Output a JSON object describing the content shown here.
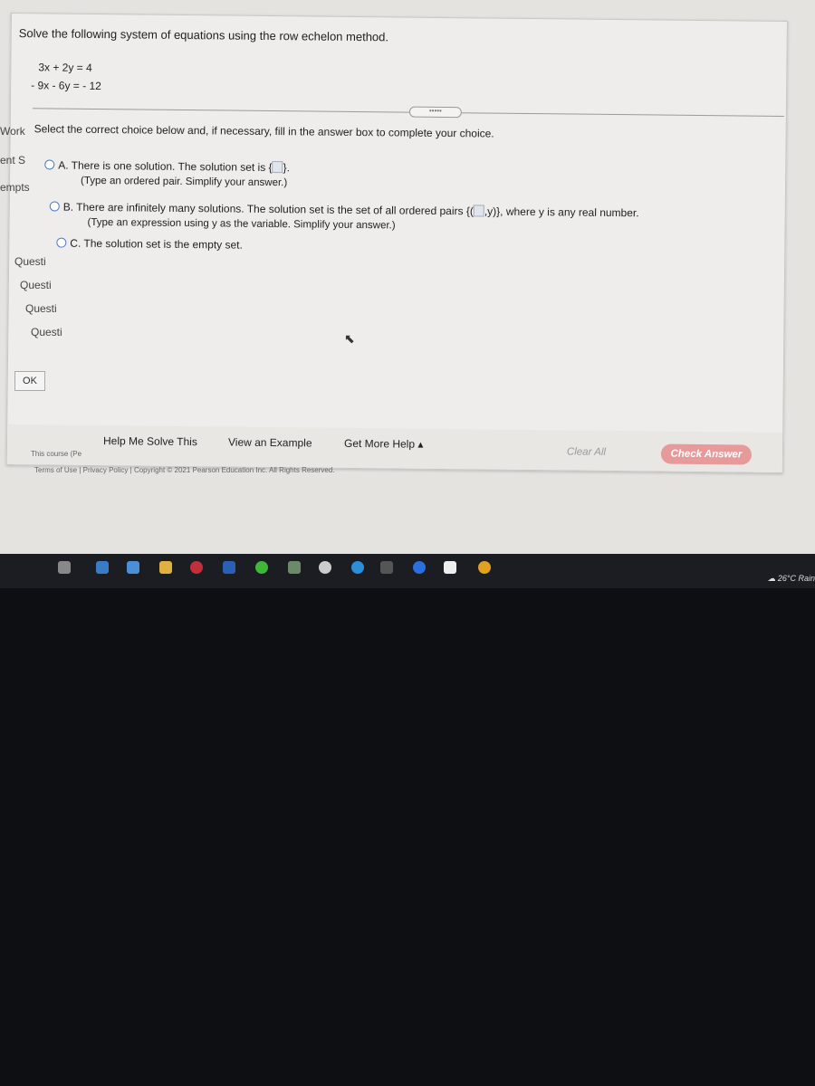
{
  "question": {
    "prompt": "Solve the following system of equations using the row echelon method.",
    "equations": [
      "3x + 2y = 4",
      "- 9x - 6y = - 12"
    ],
    "instruction": "Select the correct choice below and, if necessary, fill in the answer box to complete your choice."
  },
  "choices": [
    {
      "letter": "A.",
      "text": "There is one solution. The solution set is {",
      "suffix": "}.",
      "hint": "(Type an ordered pair. Simplify your answer.)"
    },
    {
      "letter": "B.",
      "text": "There are infinitely many solutions. The solution set is the set of all ordered pairs {(",
      "suffix": ",y)}, where y is any real number.",
      "hint": "(Type an expression using y as the variable. Simplify your answer.)"
    },
    {
      "letter": "C.",
      "text": "The solution set is the empty set."
    }
  ],
  "left_pane": [
    "Work",
    "ent S",
    "empts",
    "Questi",
    "Questi",
    "Questi",
    "Questi"
  ],
  "ok_label": "OK",
  "footer": {
    "help_me_solve": "Help Me Solve This",
    "view_example": "View an Example",
    "get_more_help": "Get More Help ▴",
    "clear_all": "Clear All",
    "check_answer": "Check Answer"
  },
  "legal": {
    "course": "This course (Pe",
    "terms": "Terms of Use | Privacy Policy | Copyright © 2021 Pearson Education Inc. All Rights Reserved."
  },
  "taskbar": {
    "weather": "26°C Rain",
    "icons": [
      "task-view",
      "photos",
      "app",
      "file-explorer",
      "opera",
      "word",
      "app-green",
      "xbox",
      "itunes",
      "telegram",
      "epic-games",
      "app-blue",
      "notepad",
      "chrome"
    ]
  },
  "colors": {
    "check_answer": "#e79a9a",
    "radio": "#4a7fc1",
    "taskbar": "#1b1d22"
  }
}
